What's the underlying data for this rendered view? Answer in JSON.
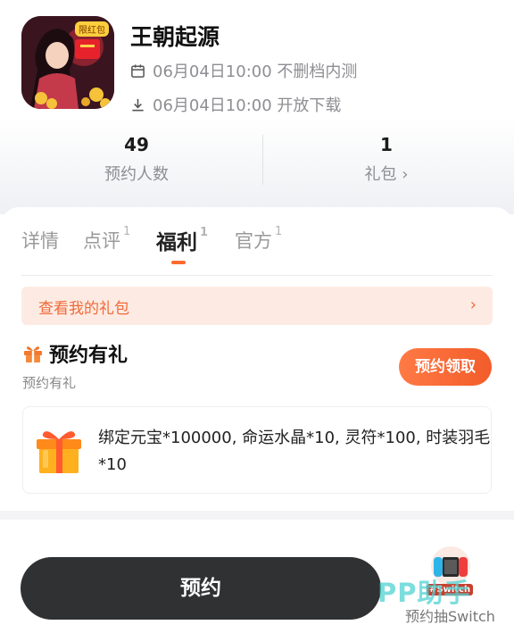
{
  "game": {
    "title": "王朝起源",
    "icon_badge": "限红包",
    "test_line": "06月04日10:00 不删档内测",
    "download_line": "06月04日10:00 开放下载"
  },
  "stats": {
    "reservations_count": "49",
    "reservations_label": "预约人数",
    "gifts_count": "1",
    "gifts_label": "礼包",
    "gifts_chevron": "›"
  },
  "tabs": [
    {
      "label": "详情",
      "count": ""
    },
    {
      "label": "点评",
      "count": "1"
    },
    {
      "label": "福利",
      "count": "1"
    },
    {
      "label": "官方",
      "count": "1"
    }
  ],
  "active_tab_index": 2,
  "my_gifts_link": {
    "label": "查看我的礼包",
    "chevron": "›"
  },
  "promo": {
    "title": "预约有礼",
    "subtitle": "预约有礼",
    "claim_label": "预约领取",
    "reward_text": "绑定元宝*100000, 命运水晶*10, 灵符*100, 时装羽毛*10"
  },
  "bottom": {
    "reserve_label": "预约",
    "switch_badge": "#Switch",
    "switch_label": "预约抽Switch",
    "watermark": "PP助手"
  },
  "colors": {
    "accent": "#f25c2a",
    "accent_light_bg": "#fdebe3",
    "dark_button": "#2f3133",
    "muted_text": "#8e8e93"
  },
  "icons": {
    "calendar": "calendar-icon",
    "download": "download-icon",
    "gift": "gift-icon",
    "chevron": "chevron-right-icon"
  }
}
